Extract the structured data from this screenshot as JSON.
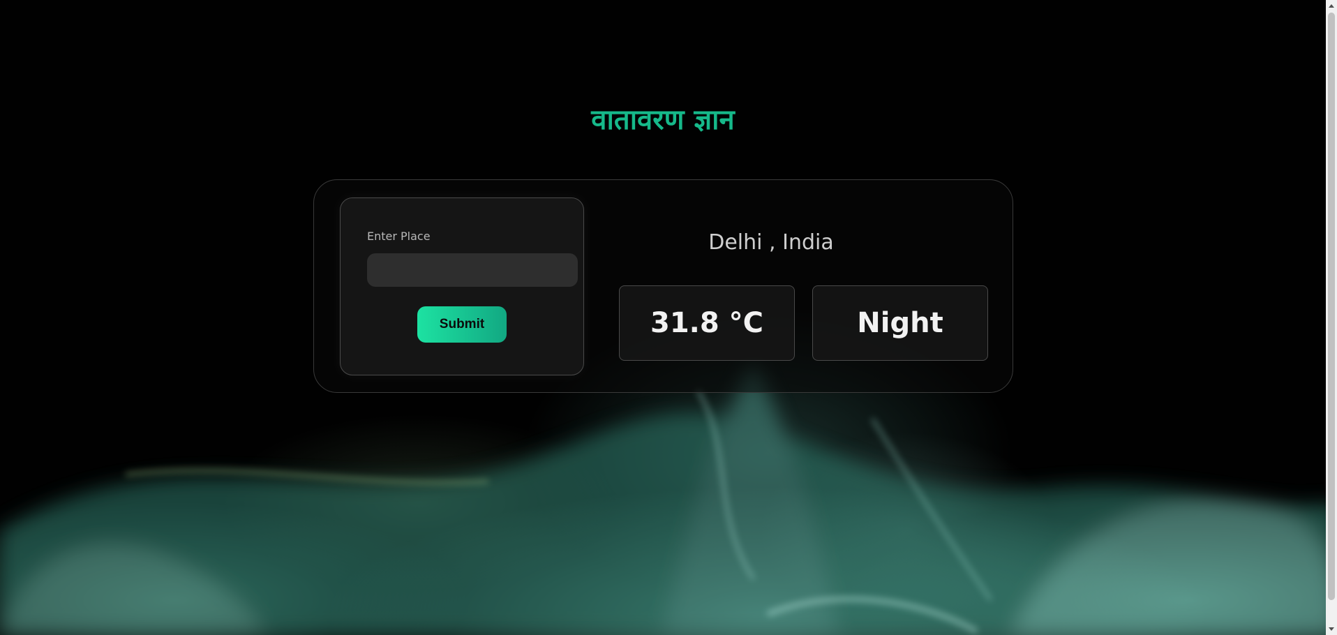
{
  "app": {
    "title": "वातावरण ज्ञान"
  },
  "form": {
    "label": "Enter Place",
    "input_value": "",
    "input_placeholder": "",
    "submit_label": "Submit"
  },
  "weather": {
    "location": "Delhi , India",
    "temperature": "31.8 °C",
    "time_of_day": "Night"
  },
  "colors": {
    "title_accent": "#16b98a",
    "button_gradient_start": "#1de2a2",
    "button_gradient_end": "#12a882",
    "background": "#010101"
  }
}
